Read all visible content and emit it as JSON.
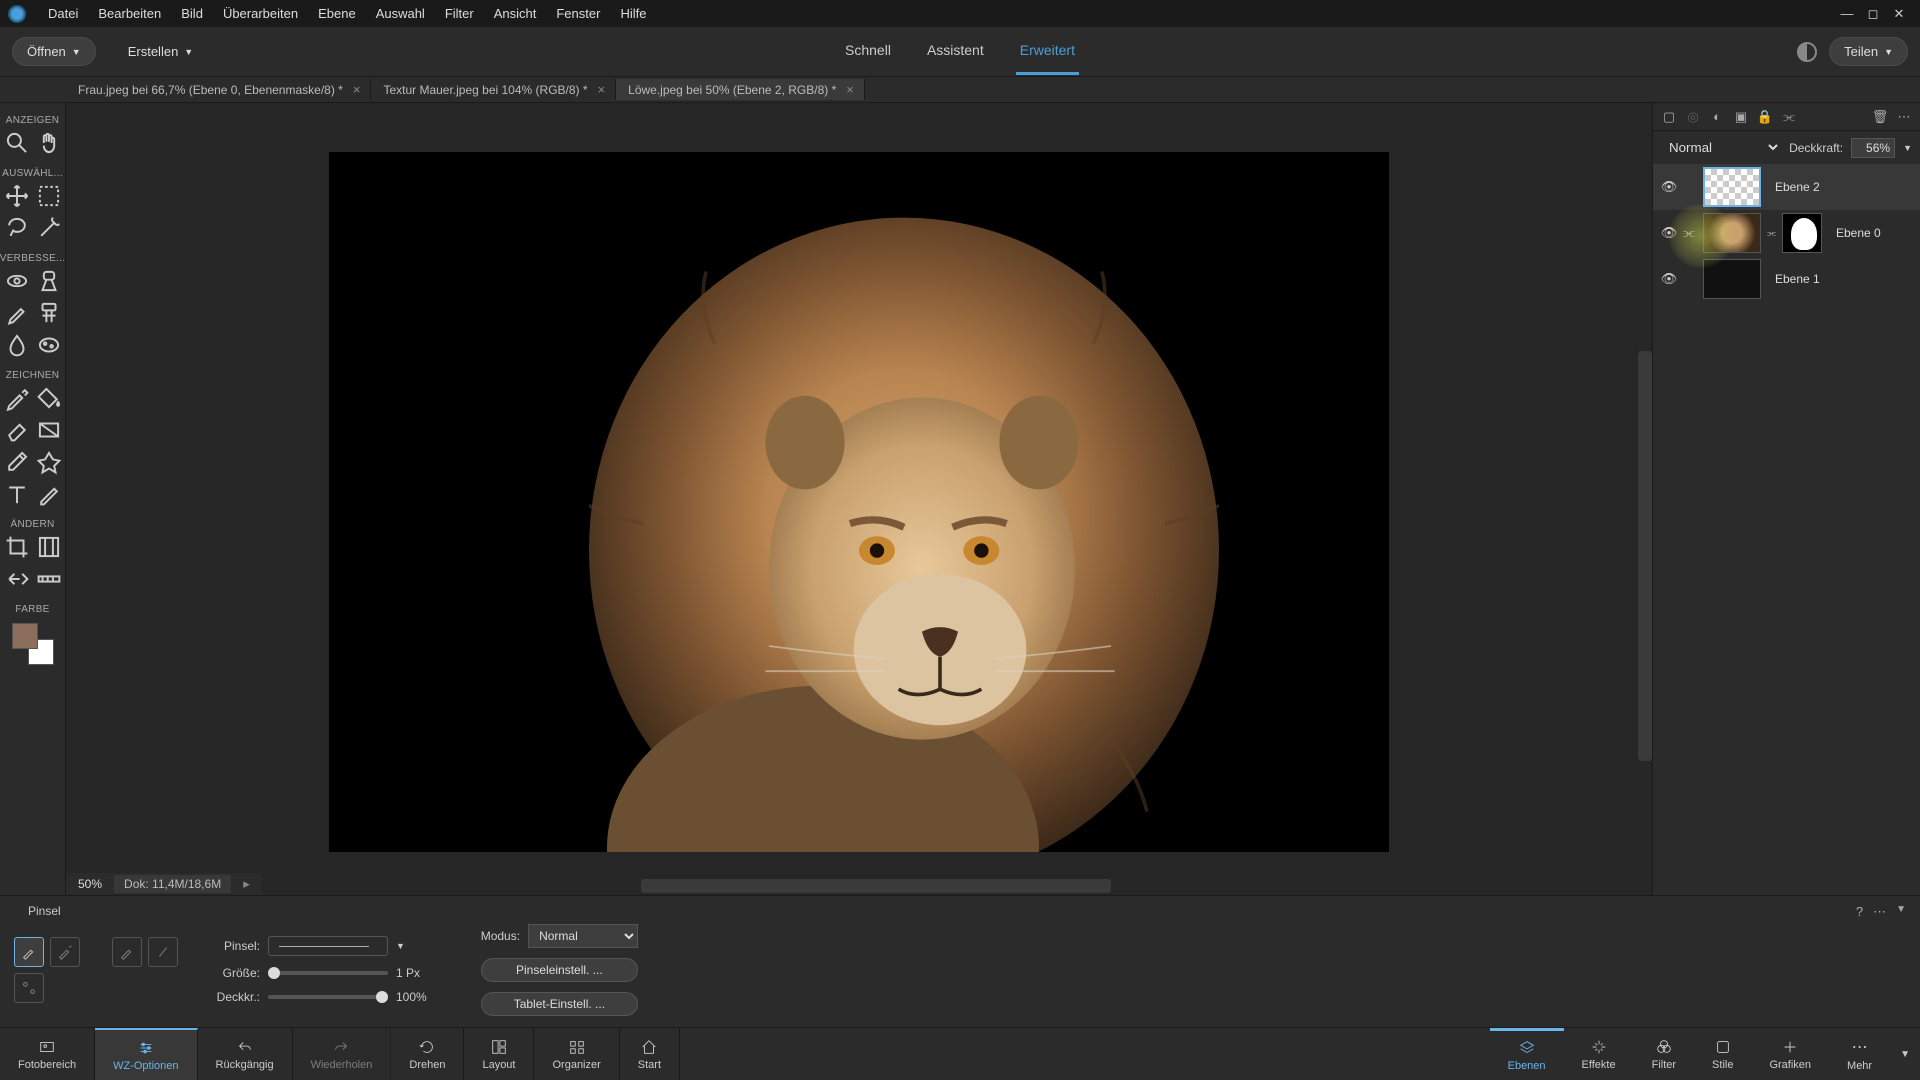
{
  "menu": {
    "items": [
      "Datei",
      "Bearbeiten",
      "Bild",
      "Überarbeiten",
      "Ebene",
      "Auswahl",
      "Filter",
      "Ansicht",
      "Fenster",
      "Hilfe"
    ]
  },
  "topbar": {
    "open": "Öffnen",
    "create": "Erstellen",
    "tabs": {
      "quick": "Schnell",
      "assistant": "Assistent",
      "expert": "Erweitert"
    },
    "share": "Teilen"
  },
  "doc_tabs": [
    {
      "label": "Frau.jpeg bei 66,7% (Ebene 0, Ebenenmaske/8) *"
    },
    {
      "label": "Textur Mauer.jpeg bei 104% (RGB/8) *"
    },
    {
      "label": "Löwe.jpeg bei 50% (Ebene 2, RGB/8) *"
    }
  ],
  "tool_sections": {
    "view": "ANZEIGEN",
    "select": "AUSWÄHL...",
    "enhance": "VERBESSE...",
    "draw": "ZEICHNEN",
    "modify": "ÄNDERN",
    "color": "FARBE"
  },
  "status": {
    "zoom": "50%",
    "doc": "Dok: 11,4M/18,6M"
  },
  "layers_panel": {
    "blend_mode": "Normal",
    "opacity_label": "Deckkraft:",
    "opacity_value": "56%",
    "layers": [
      {
        "name": "Ebene 2"
      },
      {
        "name": "Ebene 0"
      },
      {
        "name": "Ebene 1"
      }
    ]
  },
  "options": {
    "tool_name": "Pinsel",
    "brush_label": "Pinsel:",
    "size_label": "Größe:",
    "size_value": "1 Px",
    "opacity_label": "Deckkr.:",
    "opacity_value": "100%",
    "mode_label": "Modus:",
    "mode_value": "Normal",
    "btn_brush_settings": "Pinseleinstell. ...",
    "btn_tablet_settings": "Tablet-Einstell. ..."
  },
  "taskbar": {
    "photobin": "Fotobereich",
    "tool_options": "WZ-Optionen",
    "undo": "Rückgängig",
    "redo": "Wiederholen",
    "rotate": "Drehen",
    "layout": "Layout",
    "organizer": "Organizer",
    "home": "Start",
    "layers": "Ebenen",
    "effects": "Effekte",
    "filter": "Filter",
    "styles": "Stile",
    "graphics": "Grafiken",
    "more": "Mehr"
  }
}
